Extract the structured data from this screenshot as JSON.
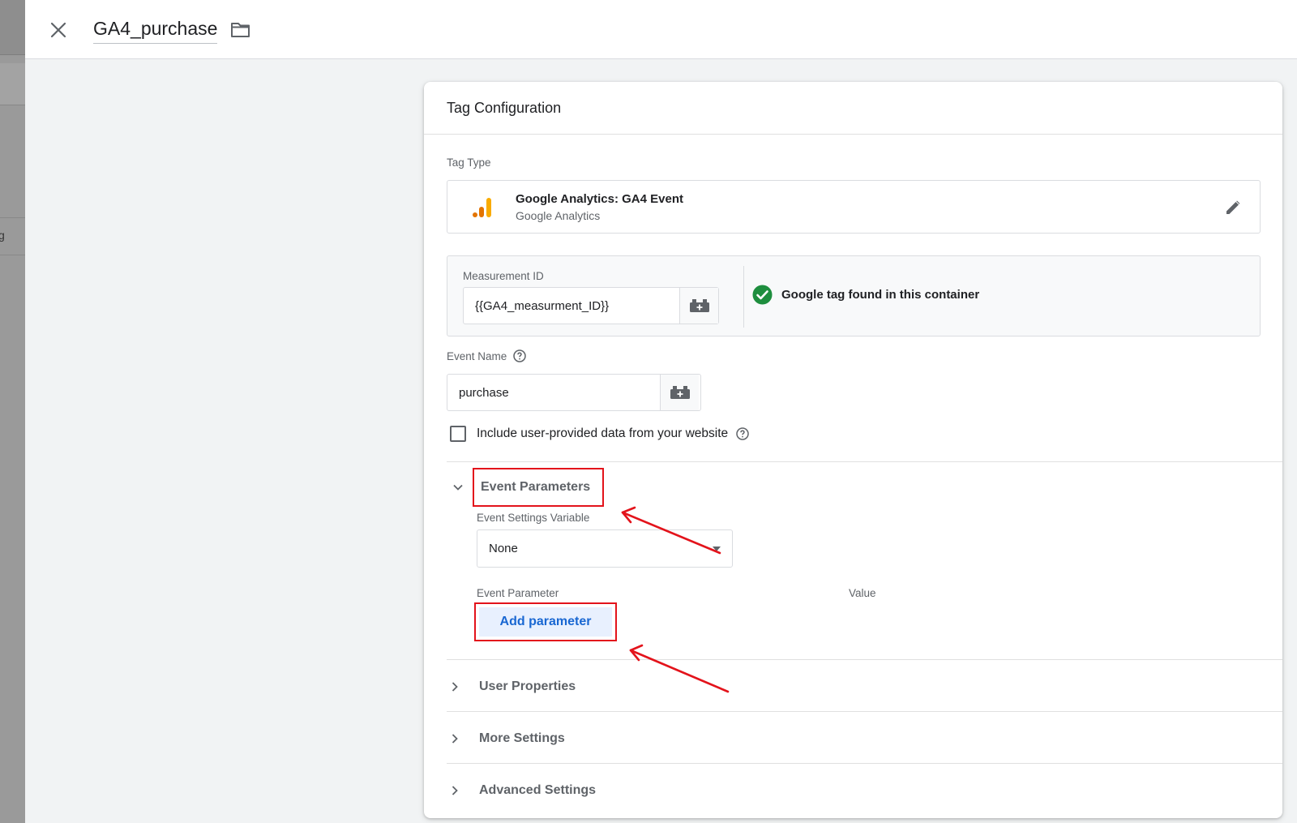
{
  "header": {
    "title": "GA4_purchase"
  },
  "background": {
    "partial_char": "g"
  },
  "card": {
    "title": "Tag Configuration",
    "tag_type_label": "Tag Type",
    "tag_type": {
      "name": "Google Analytics: GA4 Event",
      "vendor": "Google Analytics"
    },
    "measurement": {
      "label": "Measurement ID",
      "value": "{{GA4_measurment_ID}}",
      "status": "Google tag found in this container"
    },
    "event_name": {
      "label": "Event Name",
      "value": "purchase"
    },
    "checkbox": {
      "label": "Include user-provided data from your website",
      "checked": false
    },
    "event_parameters": {
      "title": "Event Parameters",
      "settings_variable_label": "Event Settings Variable",
      "settings_variable_value": "None",
      "col_parameter": "Event Parameter",
      "col_value": "Value",
      "add_button": "Add parameter"
    },
    "sections": {
      "user_properties": "User Properties",
      "more_settings": "More Settings",
      "advanced_settings": "Advanced Settings"
    }
  },
  "colors": {
    "annotation_red": "#e3131b",
    "link_blue": "#1967d2",
    "success_green": "#1e8e3e",
    "ga_orange": "#f9ab00",
    "ga_dark_orange": "#e37400"
  },
  "icons": [
    "close-icon",
    "folder-icon",
    "google-analytics-icon",
    "pencil-icon",
    "variable-icon",
    "check-circle-icon",
    "help-icon",
    "chevron-down-icon",
    "chevron-right-icon",
    "dropdown-caret-icon"
  ]
}
